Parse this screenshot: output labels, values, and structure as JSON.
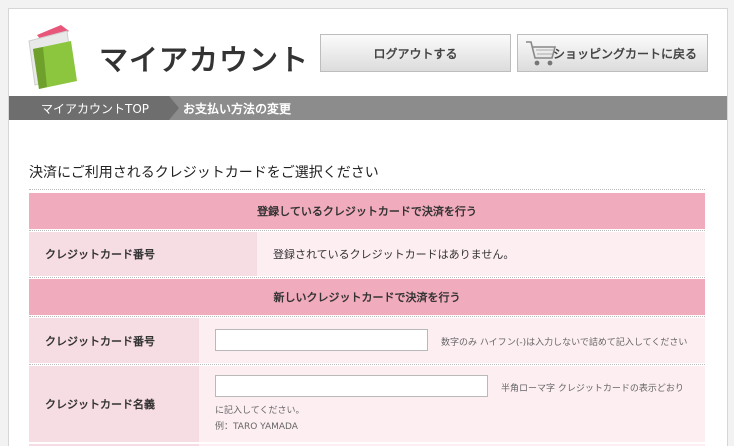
{
  "header": {
    "title": "マイアカウント",
    "logout_label": "ログアウトする",
    "cart_label": "ショッピングカートに戻る"
  },
  "breadcrumb": {
    "top": "マイアカウントTOP",
    "current": "お支払い方法の変更"
  },
  "main": {
    "heading": "決済にご利用されるクレジットカードをご選択ください",
    "registered_section": {
      "title": "登録しているクレジットカードで決済を行う",
      "card_number_label": "クレジットカード番号",
      "card_number_value": "登録されているクレジットカードはありません。"
    },
    "new_section": {
      "title": "新しいクレジットカードで決済を行う",
      "card_number_label": "クレジットカード番号",
      "card_number_input_value": "",
      "card_number_note": "数字のみ ハイフン(-)は入力しないで詰めて記入してください",
      "card_name_label": "クレジットカード名義",
      "card_name_input_value": "",
      "card_name_note_1": "半角ローマ字 クレジットカードの表示どおり",
      "card_name_note_2": "に記入してください。",
      "card_name_example": "例：TARO YAMADA"
    }
  },
  "colors": {
    "pink_band": "#f0abbd",
    "pink_label": "#f6dce3",
    "pink_row": "#fdeef2",
    "breadcrumb_bg": "#8c8c8c",
    "logo_green": "#8cc63f"
  }
}
